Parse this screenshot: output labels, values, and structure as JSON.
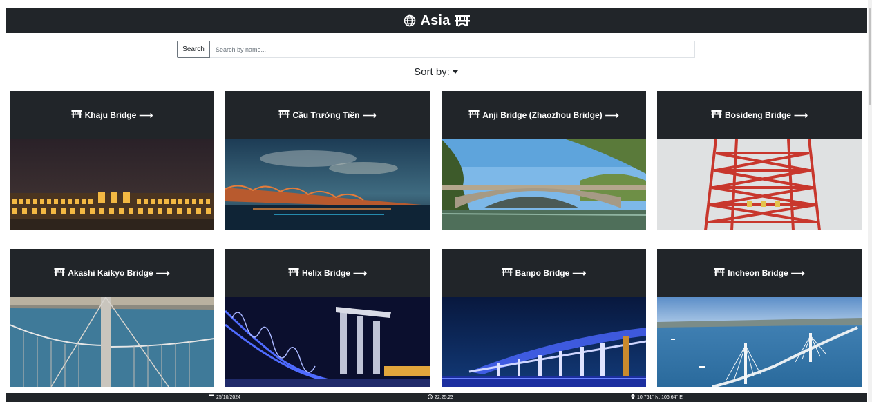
{
  "header": {
    "title": "Asia",
    "left_icon": "globe-icon",
    "right_icon": "bridge-icon"
  },
  "search": {
    "button_label": "Search",
    "placeholder": "Search by name...",
    "value": ""
  },
  "sort": {
    "label": "Sort by:"
  },
  "cards": [
    {
      "title": "Khaju Bridge",
      "arrow": "⟶",
      "icon": "bridge-icon",
      "image": "night-arched-bridge-lights-photo"
    },
    {
      "title": "Cầu Trường Tiền",
      "arrow": "⟶",
      "icon": "bridge-icon",
      "image": "truss-bridge-river-dusk-photo"
    },
    {
      "title": "Anji Bridge (Zhaozhou Bridge)",
      "arrow": "⟶",
      "icon": "bridge-icon",
      "image": "stone-arch-bridge-trees-photo"
    },
    {
      "title": "Bosideng Bridge",
      "arrow": "⟶",
      "icon": "bridge-icon",
      "image": "red-steel-tower-photo"
    },
    {
      "title": "Akashi Kaikyo Bridge",
      "arrow": "⟶",
      "icon": "bridge-icon",
      "image": "suspension-bridge-aerial-photo"
    },
    {
      "title": "Helix Bridge",
      "arrow": "⟶",
      "icon": "bridge-icon",
      "image": "helix-bridge-night-photo"
    },
    {
      "title": "Banpo Bridge",
      "arrow": "⟶",
      "icon": "bridge-icon",
      "image": "rainbow-fountain-bridge-night-photo"
    },
    {
      "title": "Incheon Bridge",
      "arrow": "⟶",
      "icon": "bridge-icon",
      "image": "cable-stayed-bridge-sea-photo"
    }
  ],
  "footer": {
    "date": "25/10/2024",
    "time": "22:25:23",
    "location": "10.761° N, 106.64° E"
  },
  "colors": {
    "header_bg": "#212529",
    "page_bg": "#ffffff",
    "text_light": "#ffffff"
  }
}
